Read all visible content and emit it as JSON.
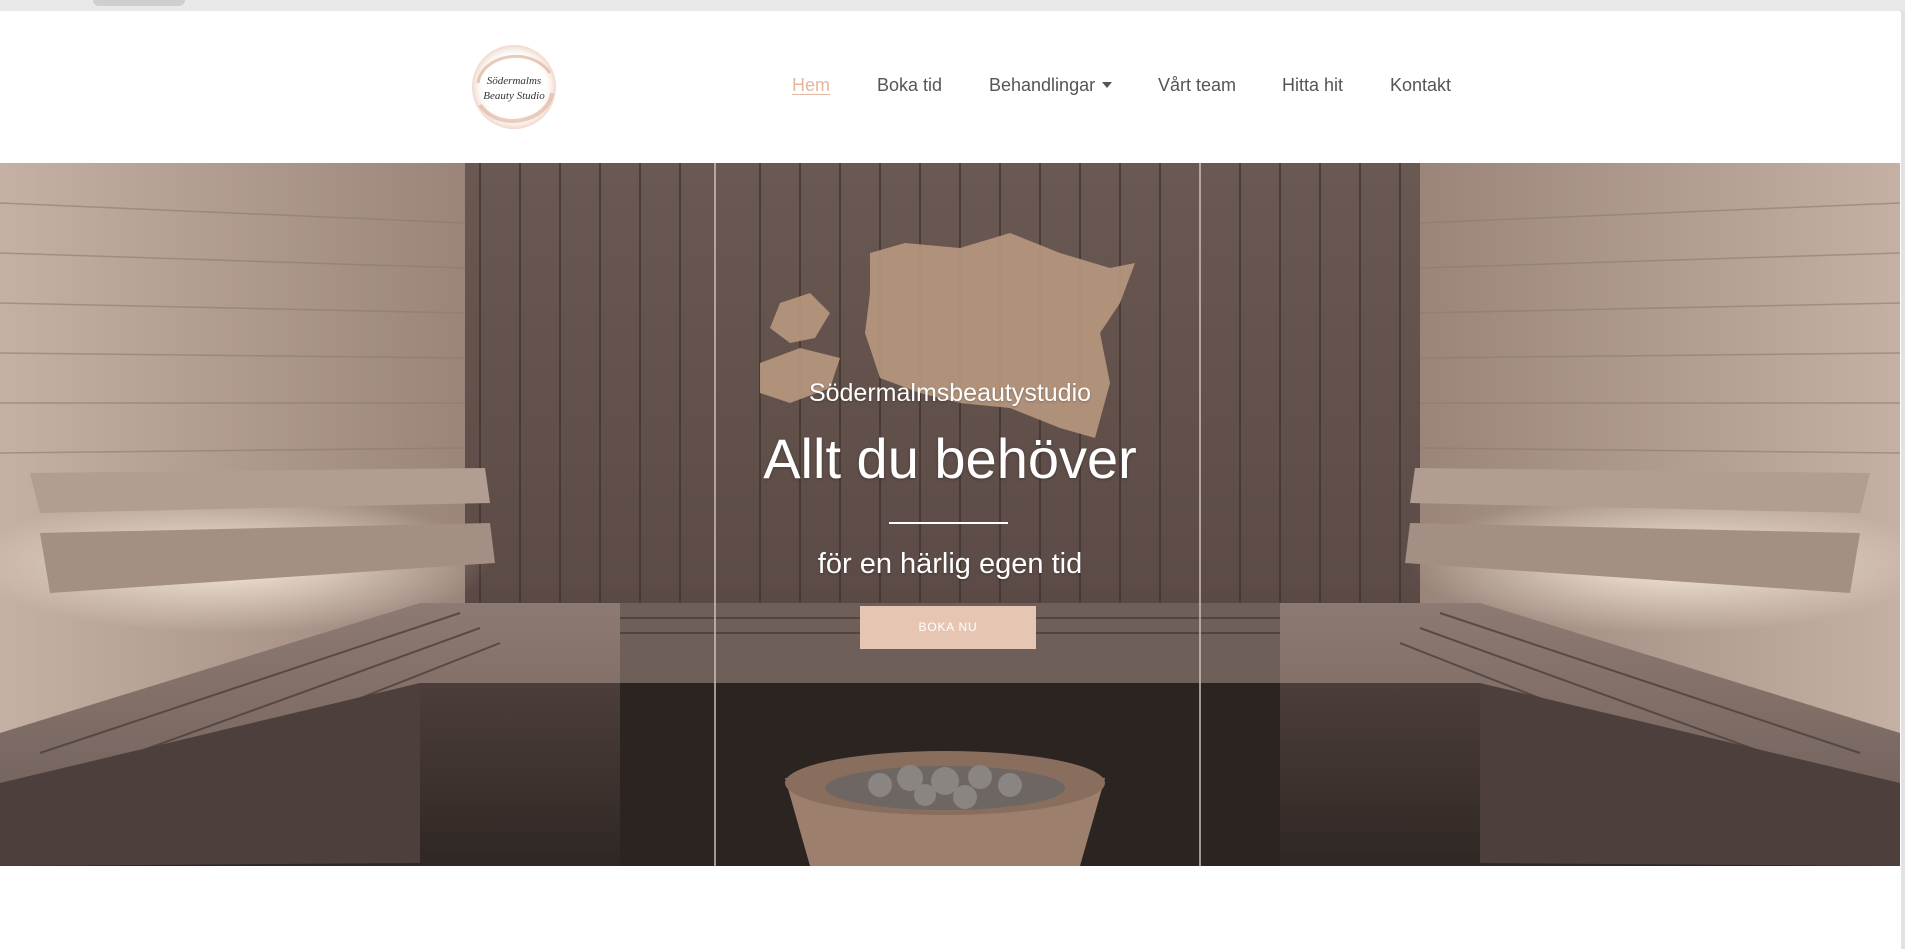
{
  "brand": {
    "logo_line1": "Södermalms",
    "logo_line2": "Beauty Studio",
    "accent_color": "#e3b7a0",
    "button_color": "#e6c6b3"
  },
  "nav": {
    "items": [
      {
        "label": "Hem",
        "active": true
      },
      {
        "label": "Boka tid"
      },
      {
        "label": "Behandlingar",
        "has_dropdown": true,
        "icon": "chevron-down-icon"
      },
      {
        "label": "Vårt team"
      },
      {
        "label": "Hitta hit"
      },
      {
        "label": "Kontakt"
      }
    ]
  },
  "hero": {
    "kicker": "Södermalmsbeautystudio",
    "title": "Allt du behöver",
    "subtitle": "för en härlig egen tid",
    "cta_label": "BOKA NU"
  }
}
